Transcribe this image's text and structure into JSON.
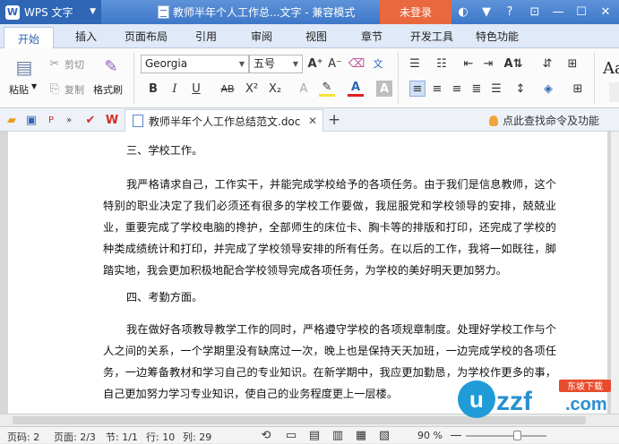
{
  "titlebar": {
    "app_name": "WPS 文字",
    "doc_title": "教师半年个人工作总...文字 - 兼容模式",
    "login_label": "未登录"
  },
  "tabs": [
    "开始",
    "插入",
    "页面布局",
    "引用",
    "审阅",
    "视图",
    "章节",
    "开发工具",
    "特色功能"
  ],
  "ribbon": {
    "paste_label": "粘贴",
    "cut_label": "剪切",
    "copy_label": "复制",
    "format_painter_label": "格式刷",
    "font_name": "Georgia",
    "font_size": "五号",
    "style_preview": "Aa"
  },
  "quickbar": {
    "doc_tab_title": "教师半年个人工作总结范文.doc",
    "search_cmd_label": "点此查找命令及功能"
  },
  "document": {
    "heading1": "三、学校工作。",
    "para1": "我严格请求自己，工作实干，并能完成学校给予的各项任务。由于我们是信息教师，这个特别的职业决定了我们必须还有很多的学校工作要做，我屈服党和学校领导的安排，兢兢业业，重要完成了学校电脑的搀护，全部师生的床位卡、胸卡等的排版和打印，还完成了学校的种类成绩统计和打印，并完成了学校领导安排的所有任务。在以后的工作，我将一如既往，脚踏实地，我会更加积极地配合学校领导完成各项任务，为学校的美好明天更加努力。",
    "heading2": "四、考勤方面。",
    "para2": "我在做好各项教导教学工作的同时，严格遵守学校的各项规章制度。处理好学校工作与个人之间的关系，一个学期里没有缺席过一次，晚上也是保持天天加班，一边完成学校的各项任务，一边筹备教材和学习自己的专业知识。在新学期中，我应更加勤恳，为学校作更多的事，自己更加努力学习专业知识，使自己的业务程度更上一层楼。"
  },
  "statusbar": {
    "page_count": "页码: 2",
    "page_of": "页面: 2/3",
    "section": "节: 1/1",
    "row": "行: 10",
    "col": "列: 29",
    "zoom": "90 %"
  },
  "watermark": {
    "brand": "uzzf",
    "sub": "东坡下载",
    "domain": ".com"
  }
}
